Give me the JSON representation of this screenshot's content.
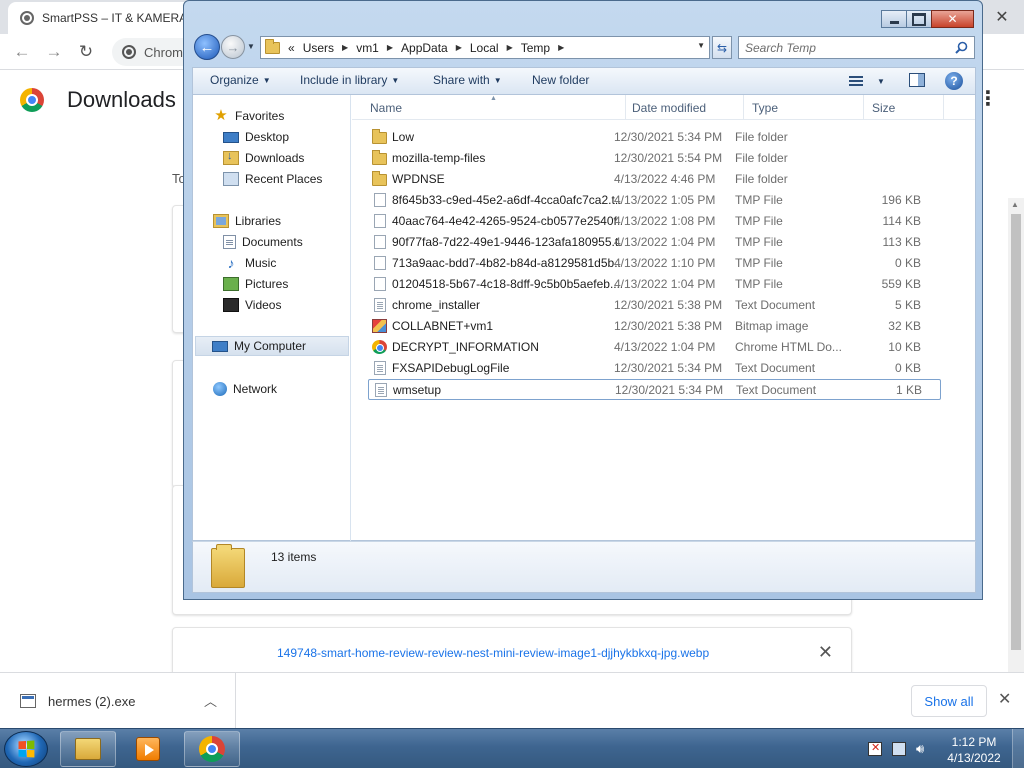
{
  "browser": {
    "tab_title": "SmartPSS – IT & KAMERA",
    "omnibox_text": "Chrom",
    "close_glyph": "✕",
    "downloads_page": {
      "title": "Downloads",
      "date_label_partial": "To",
      "visible_item_name": "149748-smart-home-review-review-nest-mini-review-image1-djjhykbkxq-jpg.webp",
      "remove_glyph": "✕"
    },
    "shelf": {
      "item_name": "hermes (2).exe",
      "show_all_label": "Show all",
      "close_glyph": "✕"
    }
  },
  "explorer": {
    "breadcrumb_overflow": "«",
    "breadcrumb": [
      "Users",
      "vm1",
      "AppData",
      "Local",
      "Temp"
    ],
    "search_placeholder": "Search Temp",
    "commands": {
      "organize": "Organize",
      "include_in_library": "Include in library",
      "share_with": "Share with",
      "new_folder": "New folder"
    },
    "nav": {
      "favorites": "Favorites",
      "desktop": "Desktop",
      "downloads": "Downloads",
      "recent_places": "Recent Places",
      "libraries": "Libraries",
      "documents": "Documents",
      "music": "Music",
      "pictures": "Pictures",
      "videos": "Videos",
      "my_computer": "My Computer",
      "network": "Network"
    },
    "columns": {
      "name": "Name",
      "date_modified": "Date modified",
      "type": "Type",
      "size": "Size"
    },
    "files": [
      {
        "name": "Low",
        "date": "12/30/2021 5:34 PM",
        "type": "File folder",
        "size": "",
        "icon": "folder-icon"
      },
      {
        "name": "mozilla-temp-files",
        "date": "12/30/2021 5:54 PM",
        "type": "File folder",
        "size": "",
        "icon": "folder-icon"
      },
      {
        "name": "WPDNSE",
        "date": "4/13/2022 4:46 PM",
        "type": "File folder",
        "size": "",
        "icon": "folder-icon"
      },
      {
        "name": "8f645b33-c9ed-45e2-a6df-4cca0afc7ca2.t...",
        "date": "4/13/2022 1:05 PM",
        "type": "TMP File",
        "size": "196 KB",
        "icon": "file-icon"
      },
      {
        "name": "40aac764-4e42-4265-9524-cb0577e2540f....",
        "date": "4/13/2022 1:08 PM",
        "type": "TMP File",
        "size": "114 KB",
        "icon": "file-icon"
      },
      {
        "name": "90f77fa8-7d22-49e1-9446-123afa180955.t...",
        "date": "4/13/2022 1:04 PM",
        "type": "TMP File",
        "size": "113 KB",
        "icon": "file-icon"
      },
      {
        "name": "713a9aac-bdd7-4b82-b84d-a8129581d5b...",
        "date": "4/13/2022 1:10 PM",
        "type": "TMP File",
        "size": "0 KB",
        "icon": "file-icon"
      },
      {
        "name": "01204518-5b67-4c18-8dff-9c5b0b5aefeb....",
        "date": "4/13/2022 1:04 PM",
        "type": "TMP File",
        "size": "559 KB",
        "icon": "file-icon"
      },
      {
        "name": "chrome_installer",
        "date": "12/30/2021 5:38 PM",
        "type": "Text Document",
        "size": "5 KB",
        "icon": "text-document-icon"
      },
      {
        "name": "COLLABNET+vm1",
        "date": "12/30/2021 5:38 PM",
        "type": "Bitmap image",
        "size": "32 KB",
        "icon": "bitmap-icon"
      },
      {
        "name": "DECRYPT_INFORMATION",
        "date": "4/13/2022 1:04 PM",
        "type": "Chrome HTML Do...",
        "size": "10 KB",
        "icon": "chrome-html-icon"
      },
      {
        "name": "FXSAPIDebugLogFile",
        "date": "12/30/2021 5:34 PM",
        "type": "Text Document",
        "size": "0 KB",
        "icon": "text-document-icon"
      },
      {
        "name": "wmsetup",
        "date": "12/30/2021 5:34 PM",
        "type": "Text Document",
        "size": "1 KB",
        "icon": "text-document-icon"
      }
    ],
    "details": {
      "item_count": "13 items"
    }
  },
  "taskbar": {
    "time": "1:12 PM",
    "date": "4/13/2022"
  }
}
